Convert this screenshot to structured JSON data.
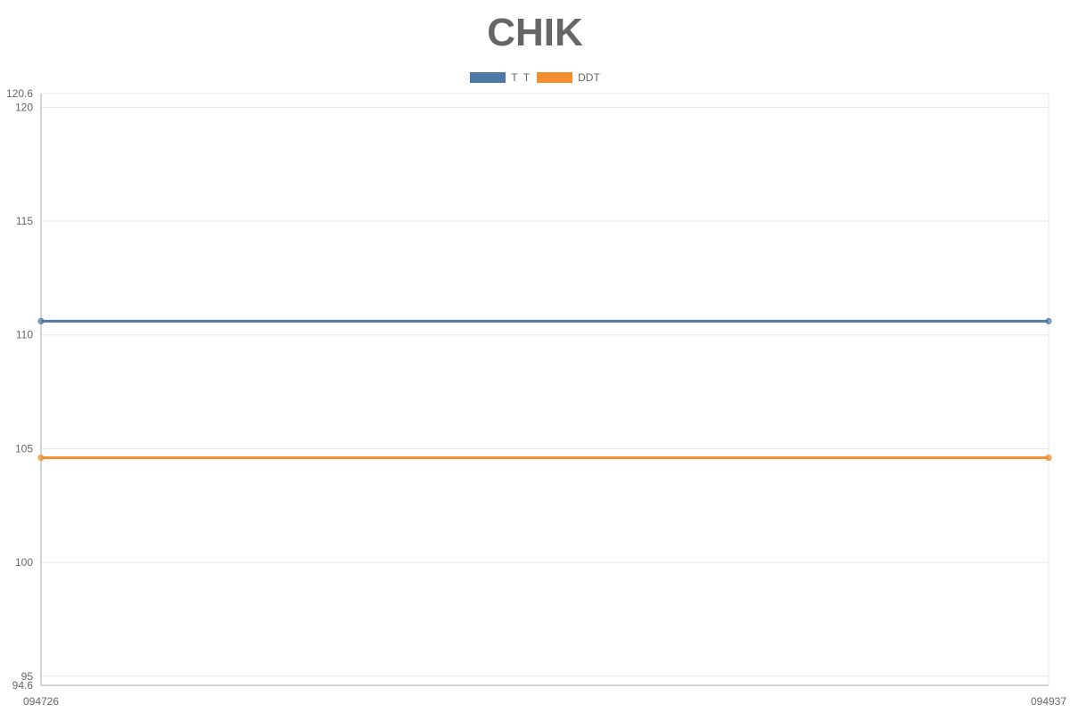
{
  "chart_data": {
    "type": "line",
    "title": "CHIK",
    "xlabel": "",
    "ylabel": "",
    "categories": [
      "094726",
      "094937"
    ],
    "series": [
      {
        "name": "T  T",
        "values": [
          110.6,
          110.6
        ],
        "color": "#4e79a7"
      },
      {
        "name": "DDT",
        "values": [
          104.6,
          104.6
        ],
        "color": "#f28e2b"
      }
    ],
    "ylim": [
      94.6,
      120.6
    ],
    "yticks": [
      "94.6",
      "95",
      "100",
      "105",
      "110",
      "115",
      "120",
      "120.6"
    ],
    "grid": true,
    "legend_position": "top"
  }
}
